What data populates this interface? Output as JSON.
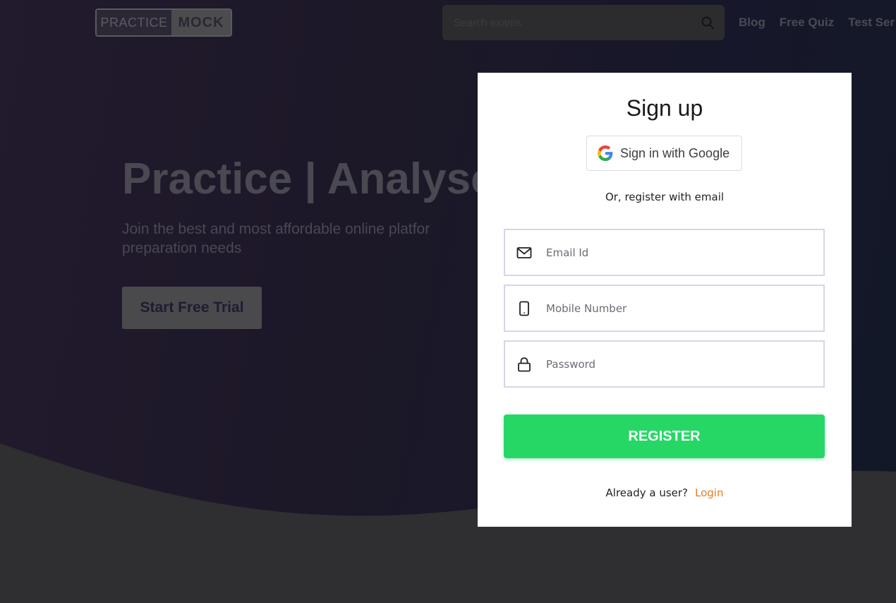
{
  "header": {
    "logo": {
      "part1": "PRACTICE",
      "part2": "MOCK"
    },
    "search": {
      "placeholder": "Search exams",
      "value": ""
    },
    "nav": [
      "Blog",
      "Free Quiz",
      "Test Ser"
    ]
  },
  "hero": {
    "title": "Practice | Analyse",
    "subtitle": "Join the best and most affordable online platfor preparation needs",
    "cta_label": "Start Free Trial"
  },
  "modal": {
    "title": "Sign up",
    "google_label": "Sign in with Google",
    "or_text": "Or, register with email",
    "fields": {
      "email": {
        "placeholder": "Email Id",
        "icon": "mail-icon"
      },
      "mobile": {
        "placeholder": "Mobile Number",
        "icon": "phone-icon"
      },
      "password": {
        "placeholder": "Password",
        "icon": "lock-icon"
      }
    },
    "register_label": "REGISTER",
    "already_text": "Already a user?",
    "login_label": "Login"
  },
  "colors": {
    "register_green": "#27d766",
    "login_orange": "#ec7a20",
    "field_border": "#d4d6ea"
  }
}
